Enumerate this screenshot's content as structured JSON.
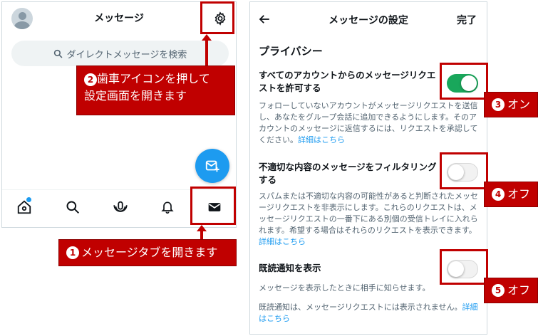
{
  "left_panel": {
    "title": "メッセージ",
    "search_placeholder": "ダイレクトメッセージを検索"
  },
  "right_panel": {
    "title": "メッセージの設定",
    "done_label": "完了",
    "section_title": "プライバシー",
    "settings": [
      {
        "label": "すべてのアカウントからのメッセージリクエストを許可する",
        "description": "フォローしていないアカウントがメッセージリクエストを送信し、あなたをグループ会話に追加できるようにします。そのアカウントのメッセージに返信するには、リクエストを承認してください。",
        "link": "詳細はこちら",
        "state": "on"
      },
      {
        "label": "不適切な内容のメッセージをフィルタリングする",
        "description": "スパムまたは不適切な内容の可能性があると判断されたメッセージリクエストを非表示にします。これらのリクエストは、メッセージリクエストの一番下にある別個の受信トレイに入れられます。希望する場合はそれらのリクエストを表示できます。",
        "link": "詳細はこちら",
        "state": "off"
      },
      {
        "label": "既読通知を表示",
        "description": "メッセージを表示したときに相手に知らせます。",
        "description2": "既読通知は、メッセージリクエストには表示されません。",
        "link": "詳細はこちら",
        "state": "off"
      }
    ]
  },
  "annotations": {
    "step1": {
      "number": "1",
      "text": "メッセージタブを開きます"
    },
    "step2": {
      "number": "2",
      "text_line1": "歯車アイコンを押して",
      "text_line2": "設定画面を開きます"
    },
    "step3": {
      "number": "3",
      "text": "オン"
    },
    "step4": {
      "number": "4",
      "text": "オフ"
    },
    "step5": {
      "number": "5",
      "text": "オフ"
    }
  },
  "colors": {
    "accent_blue": "#1d9bf0",
    "toggle_on": "#19a75b",
    "annotation_red": "#c00000"
  }
}
